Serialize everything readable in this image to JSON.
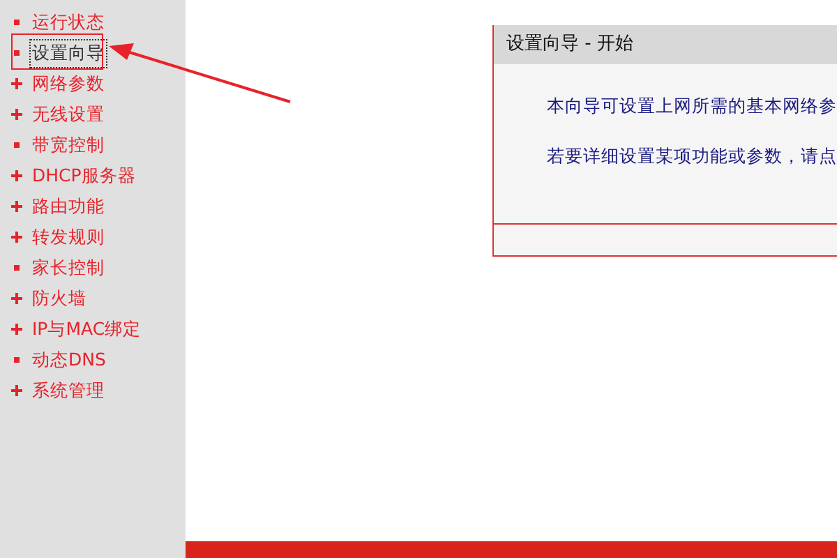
{
  "sidebar": {
    "items": [
      {
        "label": "运行状态",
        "kind": "leaf",
        "selected": false
      },
      {
        "label": "设置向导",
        "kind": "leaf",
        "selected": true
      },
      {
        "label": "网络参数",
        "kind": "expandable",
        "selected": false
      },
      {
        "label": "无线设置",
        "kind": "expandable",
        "selected": false
      },
      {
        "label": "带宽控制",
        "kind": "leaf",
        "selected": false
      },
      {
        "label": "DHCP服务器",
        "kind": "expandable",
        "selected": false
      },
      {
        "label": "路由功能",
        "kind": "expandable",
        "selected": false
      },
      {
        "label": "转发规则",
        "kind": "expandable",
        "selected": false
      },
      {
        "label": "家长控制",
        "kind": "leaf",
        "selected": false
      },
      {
        "label": "防火墙",
        "kind": "expandable",
        "selected": false
      },
      {
        "label": "IP与MAC绑定",
        "kind": "expandable",
        "selected": false
      },
      {
        "label": "动态DNS",
        "kind": "leaf",
        "selected": false
      },
      {
        "label": "系统管理",
        "kind": "expandable",
        "selected": false
      }
    ]
  },
  "panel": {
    "title": "设置向导 - 开始",
    "paragraphs": [
      "本向导可设置上网所需的基本网络参",
      "若要详细设置某项功能或参数，请点"
    ]
  }
}
